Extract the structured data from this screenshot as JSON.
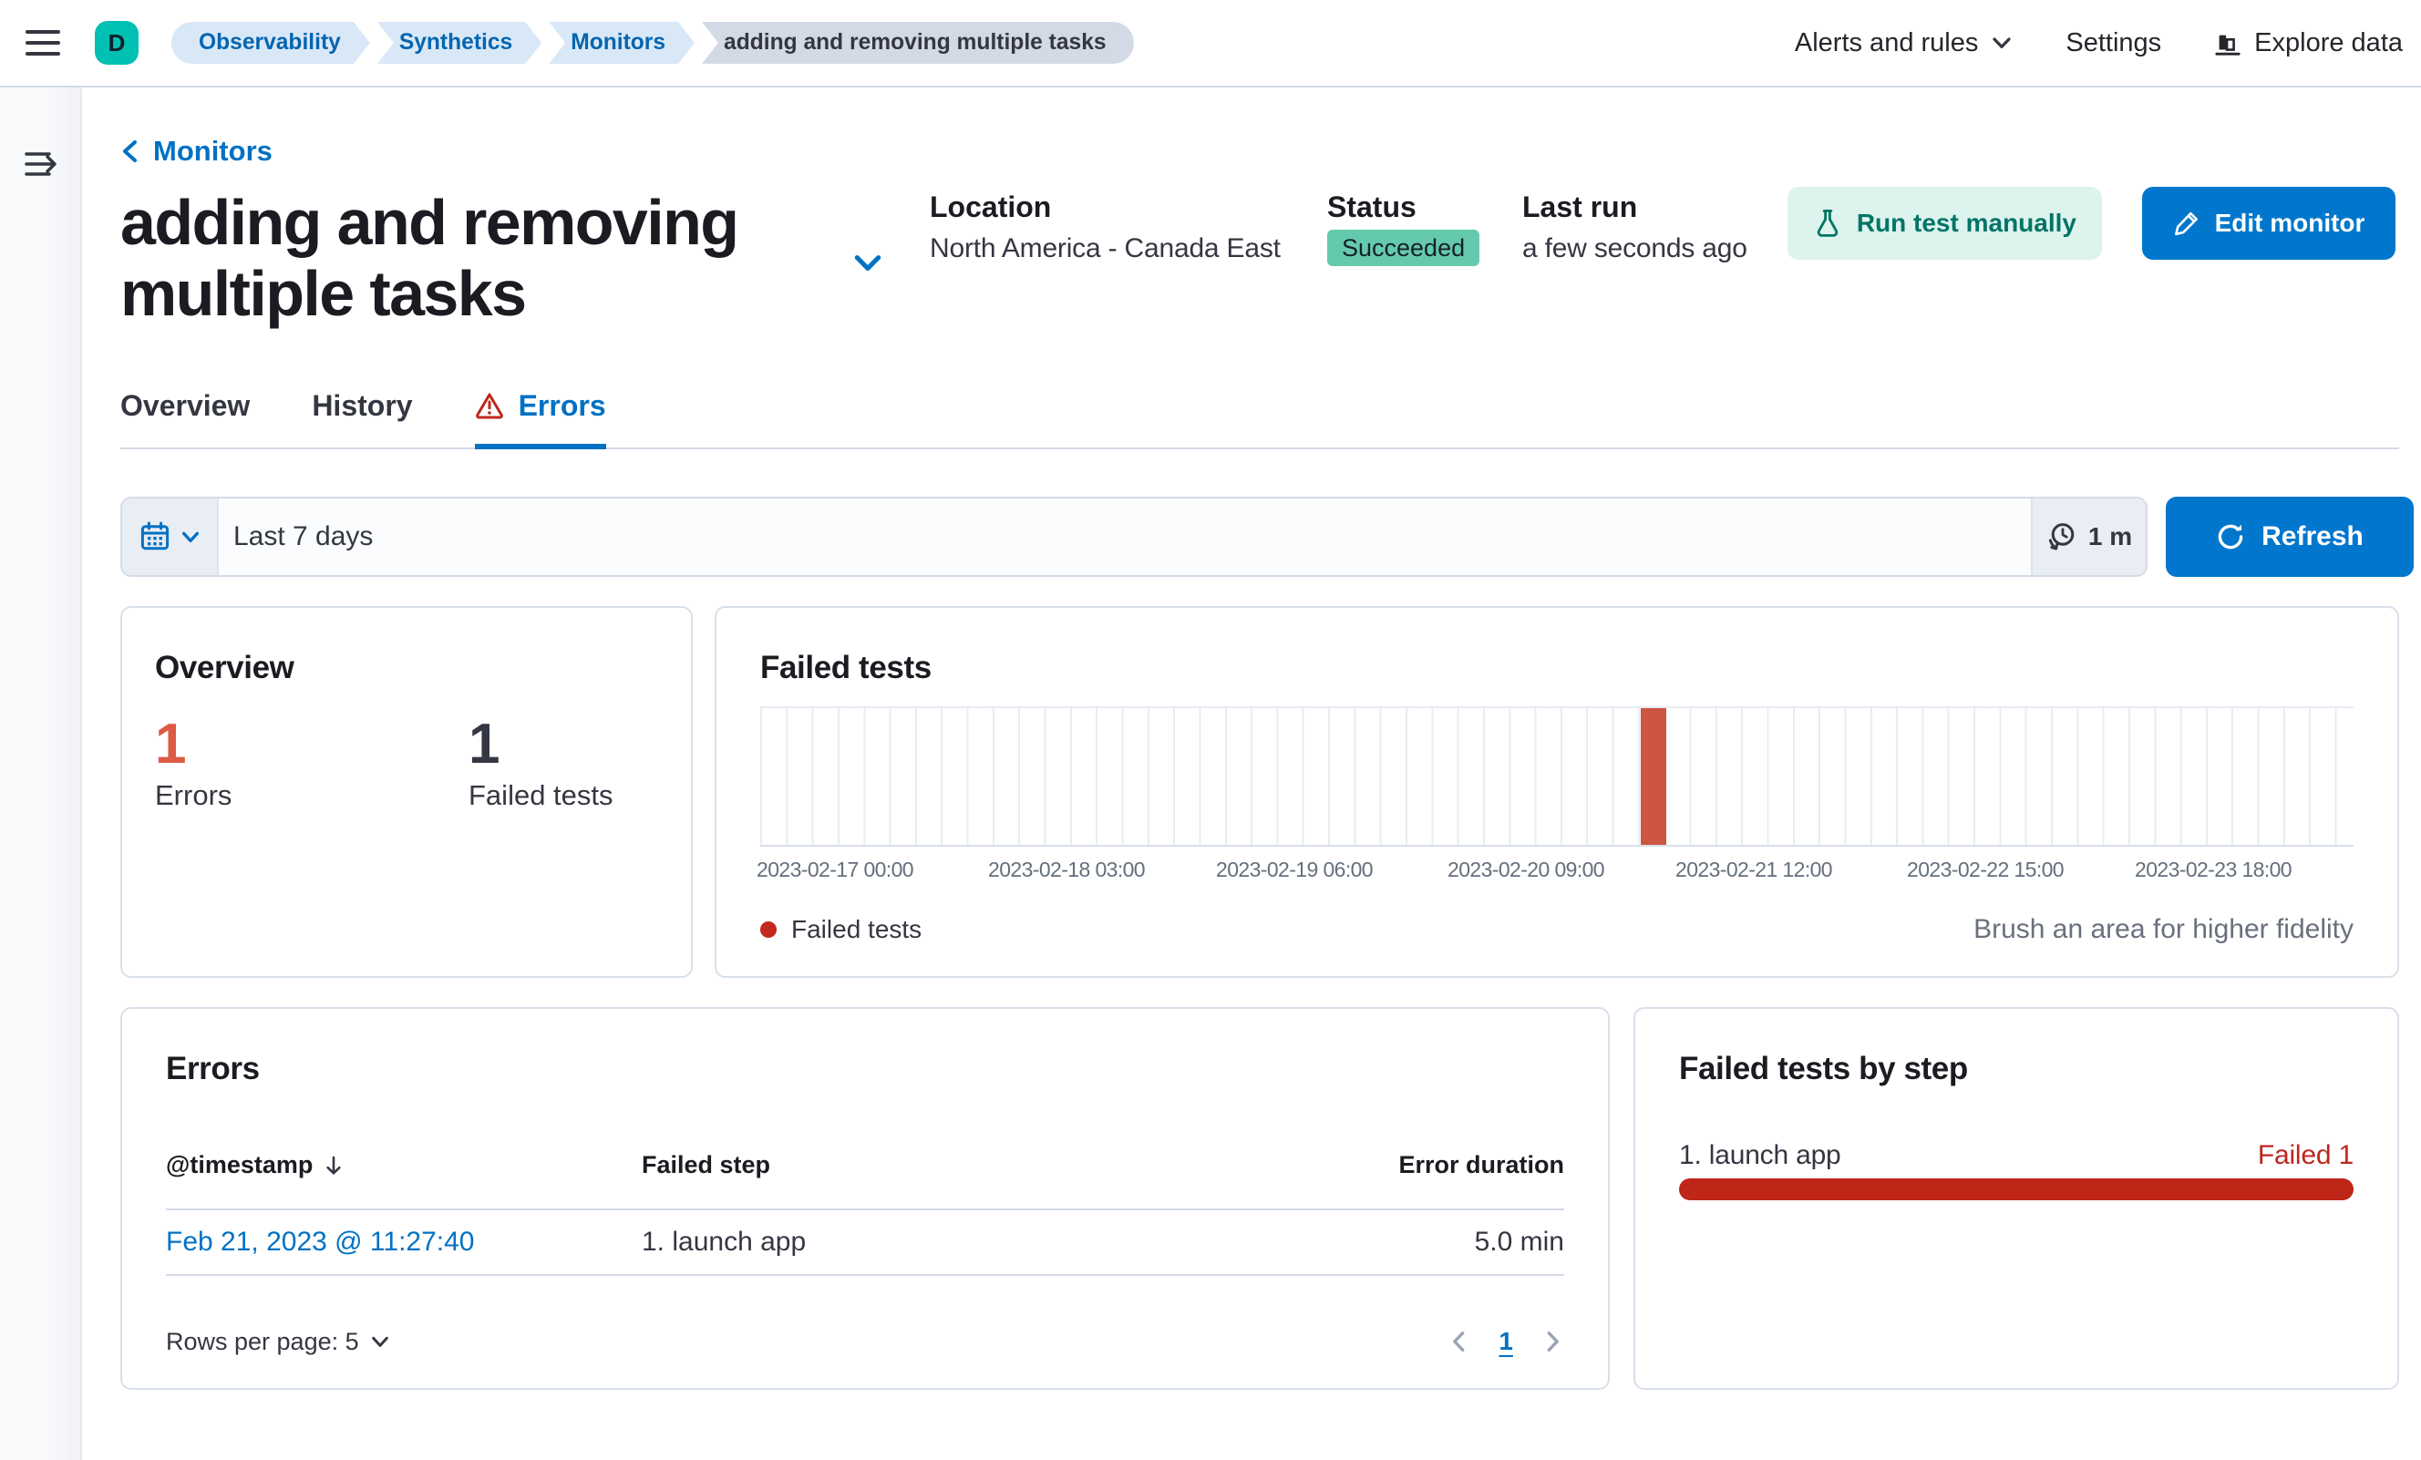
{
  "header": {
    "avatar_initial": "D",
    "breadcrumbs": [
      "Observability",
      "Synthetics",
      "Monitors",
      "adding and removing multiple tasks"
    ],
    "nav": {
      "alerts": "Alerts and rules",
      "settings": "Settings",
      "explore": "Explore data"
    }
  },
  "page": {
    "back_link": "Monitors",
    "title": "adding and removing multiple tasks",
    "meta": {
      "location_label": "Location",
      "location_value": "North America - Canada East",
      "status_label": "Status",
      "status_value": "Succeeded",
      "last_run_label": "Last run",
      "last_run_value": "a few seconds ago"
    },
    "actions": {
      "run_test": "Run test manually",
      "edit": "Edit monitor"
    },
    "tabs": {
      "overview": "Overview",
      "history": "History",
      "errors": "Errors"
    }
  },
  "datebar": {
    "range": "Last 7 days",
    "interval": "1 m",
    "refresh": "Refresh"
  },
  "overview_panel": {
    "title": "Overview",
    "stats": [
      {
        "value": "1",
        "label": "Errors"
      },
      {
        "value": "1",
        "label": "Failed tests"
      }
    ]
  },
  "chart_data": {
    "type": "bar",
    "title": "Failed tests",
    "series": [
      {
        "name": "Failed tests",
        "color": "#CC5642",
        "points": [
          {
            "x": "2023-02-21 09:00",
            "y": 1
          }
        ]
      }
    ],
    "x_ticks": [
      "2023-02-17 00:00",
      "2023-02-18 03:00",
      "2023-02-19 06:00",
      "2023-02-20 09:00",
      "2023-02-21 12:00",
      "2023-02-22 15:00",
      "2023-02-23 18:00"
    ],
    "xlabel": "",
    "ylabel": "",
    "ylim": [
      0,
      1
    ],
    "x_range": [
      "2023-02-16 21:00",
      "2023-02-24 00:00"
    ],
    "bin_hours": 3,
    "grid": "vertical",
    "legend_position": "bottom",
    "legend": [
      {
        "label": "Failed tests",
        "color": "#C4281E"
      }
    ],
    "annotation": "Brush an area for higher fidelity"
  },
  "errors_panel": {
    "title": "Errors",
    "columns": {
      "timestamp": "@timestamp",
      "failed_step": "Failed step",
      "error_duration": "Error duration"
    },
    "rows": [
      {
        "timestamp": "Feb 21, 2023 @ 11:27:40",
        "failed_step": "1. launch app",
        "error_duration": "5.0 min"
      }
    ],
    "rows_per_page": "Rows per page: 5",
    "page": "1"
  },
  "failed_by_step": {
    "title": "Failed tests by step",
    "items": [
      {
        "label": "1. launch app",
        "failed_label": "Failed 1",
        "failed_count": 1,
        "fraction": 1
      }
    ]
  },
  "colors": {
    "primary": "#0077CC",
    "link": "#0071C3",
    "success_badge": "#65C9AD",
    "success_button_bg": "#DDF3EE",
    "success_button_text": "#007466",
    "danger_text": "#BD271E",
    "error_stat": "#DD5A44",
    "chart_bar": "#CC5642",
    "bystep_bar": "#BE2617",
    "avatar": "#00BFB3"
  }
}
